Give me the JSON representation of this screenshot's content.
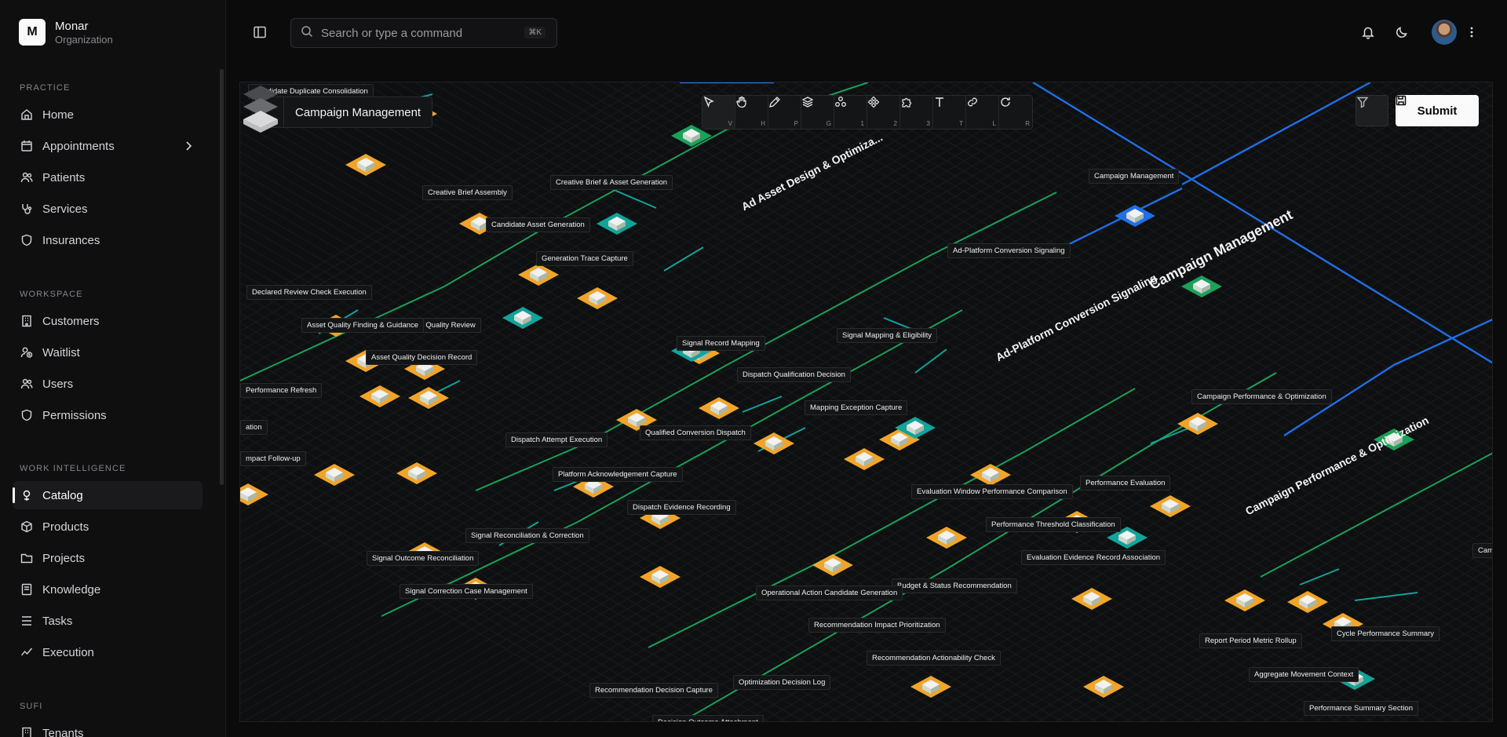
{
  "org": {
    "logo_letter": "M",
    "name": "Monar",
    "subtitle": "Organization"
  },
  "sidebar": {
    "sections": [
      {
        "label": "PRACTICE",
        "items": [
          {
            "label": "Home",
            "icon": "home-icon"
          },
          {
            "label": "Appointments",
            "icon": "calendar-icon",
            "has_chevron": true
          },
          {
            "label": "Patients",
            "icon": "users-icon"
          },
          {
            "label": "Services",
            "icon": "stethoscope-icon"
          },
          {
            "label": "Insurances",
            "icon": "shield-icon"
          }
        ]
      },
      {
        "label": "WORKSPACE",
        "items": [
          {
            "label": "Customers",
            "icon": "building-icon"
          },
          {
            "label": "Waitlist",
            "icon": "user-clock-icon"
          },
          {
            "label": "Users",
            "icon": "users-icon"
          },
          {
            "label": "Permissions",
            "icon": "shield-icon"
          }
        ]
      },
      {
        "label": "WORK INTELLIGENCE",
        "items": [
          {
            "label": "Catalog",
            "icon": "book-icon",
            "active": true
          },
          {
            "label": "Products",
            "icon": "box-icon"
          },
          {
            "label": "Projects",
            "icon": "folder-icon"
          },
          {
            "label": "Knowledge",
            "icon": "book-open-icon"
          },
          {
            "label": "Tasks",
            "icon": "list-icon"
          },
          {
            "label": "Execution",
            "icon": "activity-icon"
          }
        ]
      },
      {
        "label": "SUFI",
        "items": [
          {
            "label": "Tenants",
            "icon": "building-icon"
          }
        ]
      }
    ]
  },
  "topbar": {
    "search_placeholder": "Search or type a command",
    "search_shortcut": "⌘K"
  },
  "canvas": {
    "title": "Campaign Management",
    "submit_label": "Submit",
    "tools": [
      {
        "name": "select-tool",
        "key": "V",
        "icon": "cursor-icon",
        "active": true
      },
      {
        "name": "pan-tool",
        "key": "H",
        "icon": "hand-icon"
      },
      {
        "name": "pen-tool",
        "key": "P",
        "icon": "pen-icon"
      },
      {
        "name": "layers-tool",
        "key": "G",
        "icon": "layers-icon"
      },
      {
        "name": "cluster1-tool",
        "key": "1",
        "icon": "cluster-icon"
      },
      {
        "name": "cluster2-tool",
        "key": "2",
        "icon": "nodes-icon"
      },
      {
        "name": "plugin-tool",
        "key": "3",
        "icon": "puzzle-icon"
      },
      {
        "name": "text-tool",
        "key": "T",
        "icon": "text-icon"
      },
      {
        "name": "link-tool",
        "key": "L",
        "icon": "link-icon"
      },
      {
        "name": "reset-tool",
        "key": "R",
        "icon": "rotate-icon"
      }
    ],
    "colors": {
      "blue": "#1f6fe6",
      "green": "#1aa15a",
      "teal": "#12a39a",
      "orange": "#f0a52a",
      "grid": "#1a1b1d"
    },
    "region_labels": [
      "Ad Asset Design & Optimiza...",
      "Campaign Management",
      "Ad-Platform Conversion Signaling",
      "Campaign Performance & Optimization"
    ],
    "node_labels": [
      "Candidate Duplicate Consolidation",
      "Creative Brief & Asset Generation",
      "Creative Brief Assembly",
      "Candidate Asset Generation",
      "Generation Trace Capture",
      "Declared Review Check Execution",
      "Asset Quality Review",
      "Asset Quality Finding & Guidance",
      "Asset Quality Decision Record",
      "Performance Refresh",
      "ation",
      "mpact Follow-up",
      "Campaign Management",
      "Ad-Platform Conversion Signaling",
      "Signal Record Mapping",
      "Signal Mapping & Eligibility",
      "Dispatch Qualification Decision",
      "Mapping Exception Capture",
      "Dispatch Attempt Execution",
      "Qualified Conversion Dispatch",
      "Platform Acknowledgement Capture",
      "Dispatch Evidence Recording",
      "Signal Reconciliation & Correction",
      "Signal Outcome Reconciliation",
      "Signal Correction Case Management",
      "Campaign Performance & Optimization",
      "Performance Evaluation",
      "Evaluation Window Performance Comparison",
      "Performance Threshold Classification",
      "Evaluation Evidence Record Association",
      "Budget & Status Recommendation",
      "Operational Action Candidate Generation",
      "Recommendation Impact Prioritization",
      "Recommendation Actionability Check",
      "Optimization Decision Log",
      "Recommendation Decision Capture",
      "Decision Outcome Attachment",
      "Report Period Metric Rollup",
      "Cycle Performance Summary",
      "Aggregate Movement Context",
      "Performance Summary Section",
      "Camp"
    ]
  }
}
